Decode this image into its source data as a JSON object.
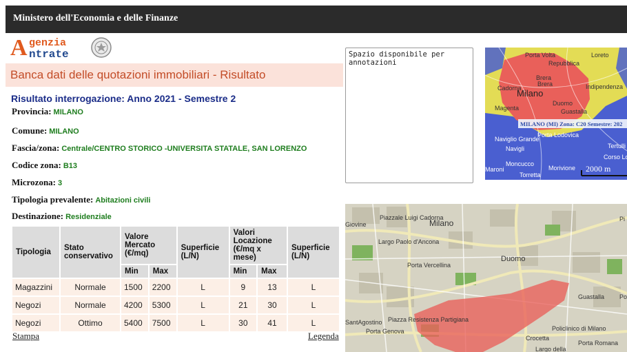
{
  "header": {
    "title": "Ministero dell'Economia e delle Finanze"
  },
  "logo": {
    "line1": "genzia",
    "line2": "ntrate",
    "initial": "A"
  },
  "banner": {
    "title": "Banca dati delle quotazioni immobiliari - Risultato"
  },
  "result": {
    "heading": "Risultato interrogazione: Anno 2021 - Semestre 2",
    "fields": [
      {
        "label": "Provincia:",
        "value": "MILANO"
      },
      {
        "label": "Comune:",
        "value": "MILANO"
      },
      {
        "label": "Fascia/zona:",
        "value": "Centrale/CENTRO STORICO -UNIVERSITA STATALE, SAN LORENZO"
      },
      {
        "label": "Codice zona:",
        "value": "B13"
      },
      {
        "label": "Microzona:",
        "value": "3"
      },
      {
        "label": "Tipologia prevalente:",
        "value": "Abitazioni civili"
      },
      {
        "label": "Destinazione:",
        "value": "Residenziale"
      }
    ]
  },
  "table": {
    "headers": {
      "tipologia": "Tipologia",
      "stato": "Stato conservativo",
      "valore_mercato": "Valore Mercato (€/mq)",
      "superficie": "Superficie (L/N)",
      "valori_locazione": "Valori Locazione (€/mq x mese)",
      "superficie2": "Superficie (L/N)",
      "min": "Min",
      "max": "Max"
    },
    "rows": [
      {
        "tipologia": "Magazzini",
        "stato": "Normale",
        "vm_min": "1500",
        "vm_max": "2200",
        "sup": "L",
        "vl_min": "9",
        "vl_max": "13",
        "sup2": "L"
      },
      {
        "tipologia": "Negozi",
        "stato": "Normale",
        "vm_min": "4200",
        "vm_max": "5300",
        "sup": "L",
        "vl_min": "21",
        "vl_max": "30",
        "sup2": "L"
      },
      {
        "tipologia": "Negozi",
        "stato": "Ottimo",
        "vm_min": "5400",
        "vm_max": "7500",
        "sup": "L",
        "vl_min": "30",
        "vl_max": "41",
        "sup2": "L"
      }
    ]
  },
  "links": {
    "stampa": "Stampa",
    "legenda": "Legenda"
  },
  "notes": {
    "value": "Spazio disponibile per annotazioni"
  },
  "map1": {
    "labels": [
      "Porta Volta",
      "Loreto",
      "Repubblica",
      "Brera",
      "Brera",
      "Cadorna",
      "Milano",
      "Indipendenza",
      "Duomo",
      "Magenta",
      "Guastalla",
      "Naviglio Grande",
      "Porta Lodovica",
      "Navigli",
      "Moncucco",
      "Morivione",
      "Torretta",
      "Maroni",
      "Tertulli",
      "Corso Lod"
    ],
    "zone_caption": "MILANO (MI) Zona: C20 Semestre: 202",
    "scale": "2000 m"
  },
  "map2": {
    "labels": [
      "Piazzale Luigi Cadorna",
      "Milano",
      "Giovine",
      "Largo Paolo d'Ancona",
      "Porta Vercellina",
      "Duomo",
      "Guastalla",
      "Por",
      "SantAgostino",
      "Piazza Resistenza Partigiana",
      "Porta Genova",
      "Crocetta",
      "Policlinico di Milano",
      "Porta Romana",
      "Largo della",
      "Pi"
    ]
  },
  "colors": {
    "topbar": "#2b2b2b",
    "banner": "#fbe2da",
    "accent": "#c34c27",
    "heading": "#1a2c88",
    "value_green": "#1e7d1e",
    "zone_red": "#e9605a"
  }
}
